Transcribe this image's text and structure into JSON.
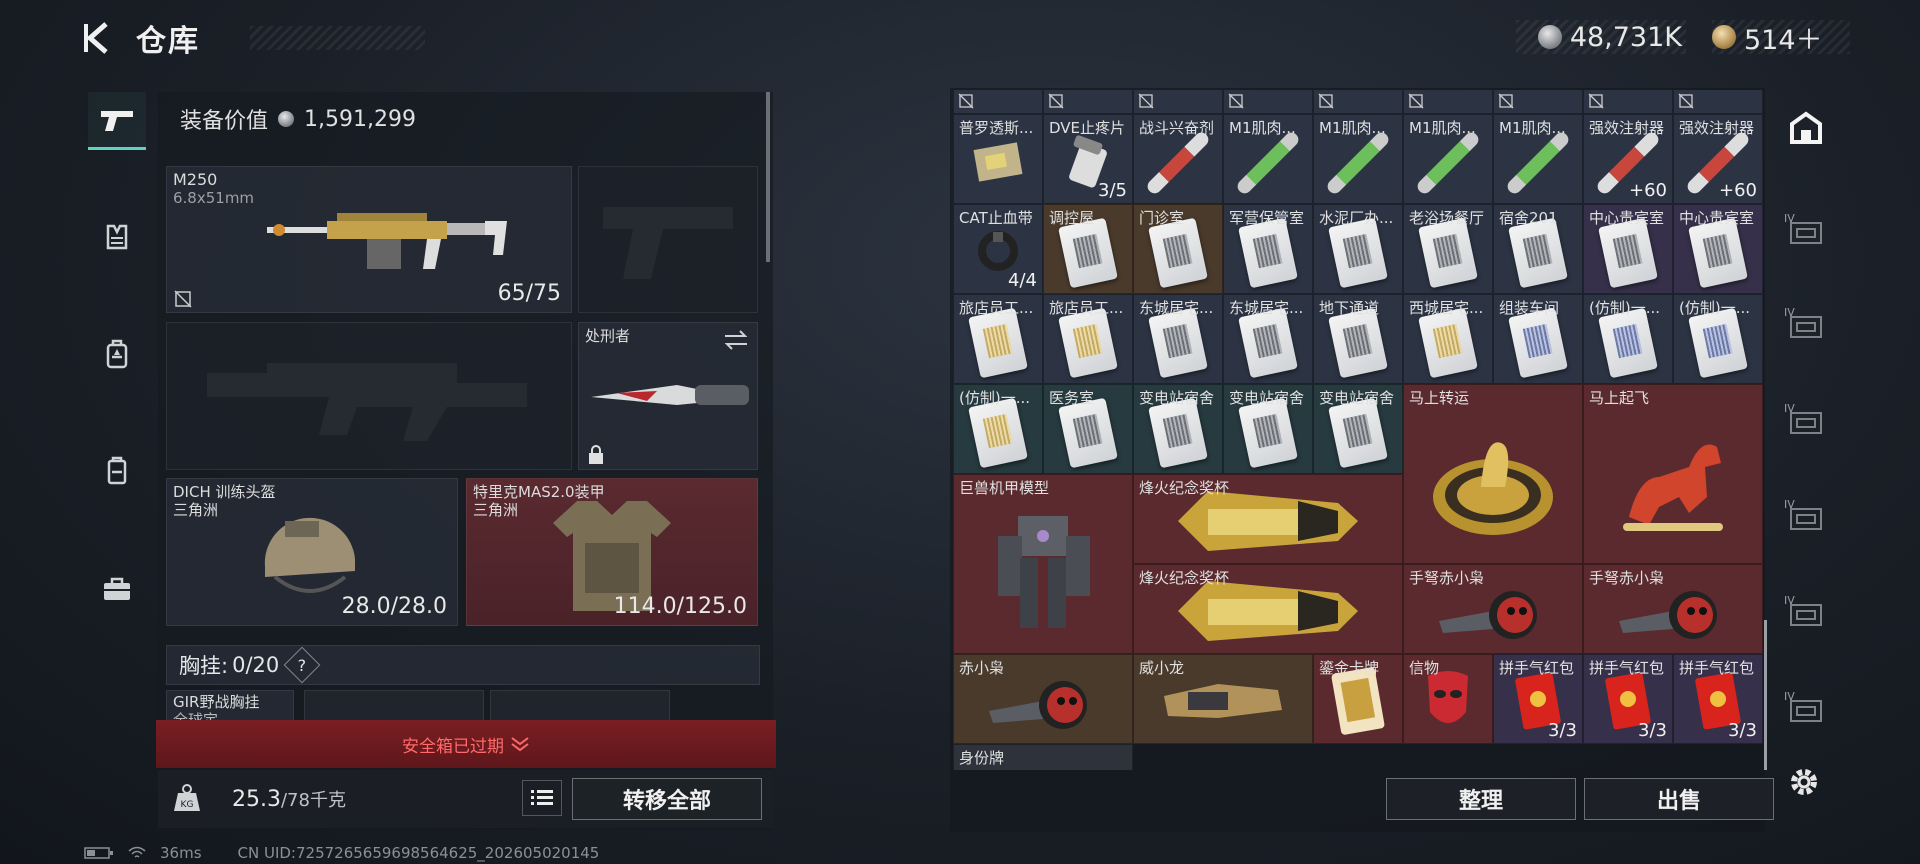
{
  "header": {
    "title": "仓库",
    "silver": "48,731K",
    "gold": "514＋"
  },
  "equipment": {
    "value_label": "装备价值",
    "value": "1,591,299",
    "primary": {
      "name": "M250",
      "caliber": "6.8x51mm",
      "ammo": "65/75"
    },
    "melee": {
      "label": "处刑者"
    },
    "helmet": {
      "name": "DICH 训练头盔",
      "origin": "三角洲",
      "durability": "28.0/28.0"
    },
    "armor": {
      "name": "特里克MAS2.0装甲",
      "origin": "三角洲",
      "durability": "114.0/125.0"
    },
    "chest": {
      "label": "胸挂:",
      "value": "0/20",
      "help": "?"
    },
    "chest_item": {
      "name": "GIR野战胸挂",
      "sub": "全球定..."
    },
    "safebox": "安全箱已过期",
    "weight": "25.3",
    "weight_max": "/78千克",
    "transfer_all": "转移全部"
  },
  "storage": {
    "sort_label": "整理",
    "sell_label": "出售",
    "last_row_label": "身份牌",
    "rows": [
      [
        {
          "name": "普罗透斯...",
          "count": "",
          "color": "bg-blue",
          "icon": "kit"
        },
        {
          "name": "DVE止疼片",
          "count": "3/5",
          "color": "bg-blue",
          "icon": "pills"
        },
        {
          "name": "战斗兴奋剂",
          "count": "",
          "color": "bg-blue",
          "icon": "syr-red"
        },
        {
          "name": "M1肌肉...",
          "count": "",
          "color": "bg-blue",
          "icon": "syr-green"
        },
        {
          "name": "M1肌肉...",
          "count": "",
          "color": "bg-blue",
          "icon": "syr-green"
        },
        {
          "name": "M1肌肉...",
          "count": "",
          "color": "bg-blue",
          "icon": "syr-green"
        },
        {
          "name": "M1肌肉...",
          "count": "",
          "color": "bg-blue",
          "icon": "syr-green"
        },
        {
          "name": "强效注射器",
          "count": "+60",
          "color": "bg-blue",
          "icon": "syr-red"
        },
        {
          "name": "强效注射器",
          "count": "+60",
          "color": "bg-blue",
          "icon": "syr-red"
        }
      ],
      [
        {
          "name": "CAT止血带",
          "count": "4/4",
          "color": "bg-blue",
          "icon": "tourniquet"
        },
        {
          "name": "调控屋",
          "count": "",
          "color": "bg-brown",
          "icon": "card"
        },
        {
          "name": "门诊室",
          "count": "",
          "color": "bg-brown",
          "icon": "card"
        },
        {
          "name": "军营保管室",
          "count": "",
          "color": "bg-blue",
          "icon": "card"
        },
        {
          "name": "水泥厂办...",
          "count": "",
          "color": "bg-blue",
          "icon": "card"
        },
        {
          "name": "老浴场餐厅",
          "count": "",
          "color": "bg-blue",
          "icon": "card"
        },
        {
          "name": "宿舍201",
          "count": "",
          "color": "bg-blue",
          "icon": "card"
        },
        {
          "name": "中心贵宾室",
          "count": "",
          "color": "bg-purple",
          "icon": "card"
        },
        {
          "name": "中心贵宾室",
          "count": "",
          "color": "bg-purple",
          "icon": "card"
        }
      ],
      [
        {
          "name": "旅店员工...",
          "count": "",
          "color": "bg-blue",
          "icon": "card-gold"
        },
        {
          "name": "旅店员工...",
          "count": "",
          "color": "bg-blue",
          "icon": "card-gold"
        },
        {
          "name": "东城居宅...",
          "count": "",
          "color": "bg-blue",
          "icon": "card"
        },
        {
          "name": "东城居宅...",
          "count": "",
          "color": "bg-blue",
          "icon": "card"
        },
        {
          "name": "地下通道",
          "count": "",
          "color": "bg-blue",
          "icon": "card"
        },
        {
          "name": "西城居宅...",
          "count": "",
          "color": "bg-blue",
          "icon": "card-gold"
        },
        {
          "name": "组装车间",
          "count": "",
          "color": "bg-blue",
          "icon": "card-blue"
        },
        {
          "name": "(仿制)一...",
          "count": "",
          "color": "bg-blue",
          "icon": "card-blue"
        },
        {
          "name": "(仿制)一...",
          "count": "",
          "color": "bg-blue",
          "icon": "card-blue"
        }
      ],
      [
        {
          "name": "(仿制)一...",
          "count": "",
          "color": "bg-teal",
          "icon": "card-gold"
        },
        {
          "name": "医务室",
          "count": "",
          "color": "bg-teal",
          "icon": "card"
        },
        {
          "name": "变电站宿舍",
          "count": "",
          "color": "bg-teal",
          "icon": "card"
        },
        {
          "name": "变电站宿舍",
          "count": "",
          "color": "bg-teal",
          "icon": "card"
        },
        {
          "name": "变电站宿舍",
          "count": "",
          "color": "bg-teal",
          "icon": "card"
        }
      ]
    ],
    "big_items": [
      {
        "name": "马上转运",
        "count": "",
        "color": "bg-red",
        "icon": "compass"
      },
      {
        "name": "马上起飞",
        "count": "",
        "color": "bg-red",
        "icon": "horse"
      },
      {
        "name": "巨兽机甲模型",
        "count": "",
        "color": "bg-red",
        "icon": "mech"
      },
      {
        "name": "烽火纪念奖杯",
        "count": "",
        "color": "bg-red",
        "icon": "trophy"
      },
      {
        "name": "烽火纪念奖杯",
        "count": "",
        "color": "bg-red",
        "icon": "trophy"
      },
      {
        "name": "手弩赤小枭",
        "count": "",
        "color": "bg-red",
        "icon": "crossbow"
      },
      {
        "name": "手弩赤小枭",
        "count": "",
        "color": "bg-red",
        "icon": "crossbow"
      }
    ],
    "last_row": [
      {
        "name": "赤小枭",
        "count": "",
        "color": "bg-brown",
        "icon": "crossbow"
      },
      {
        "name": "威小龙",
        "count": "",
        "color": "bg-brown",
        "icon": "gauntlet"
      },
      {
        "name": "鎏金卡牌",
        "count": "",
        "color": "bg-red",
        "icon": "goldcard"
      },
      {
        "name": "信物",
        "count": "",
        "color": "bg-red",
        "icon": "mask"
      },
      {
        "name": "拼手气红包",
        "count": "3/3",
        "color": "bg-purple",
        "icon": "envelope"
      },
      {
        "name": "拼手气红包",
        "count": "3/3",
        "color": "bg-purple",
        "icon": "envelope"
      },
      {
        "name": "拼手气红包",
        "count": "3/3",
        "color": "bg-purple",
        "icon": "envelope"
      }
    ]
  },
  "right_nav": [
    {
      "icon": "home-icon"
    },
    {
      "tag": "IV"
    },
    {
      "tag": "IV"
    },
    {
      "tag": "IV"
    },
    {
      "tag": "IV"
    },
    {
      "tag": "IV"
    },
    {
      "tag": "IV"
    }
  ],
  "status": {
    "ping": "36ms",
    "uid": "CN UID:7257265659698564625_202605020145"
  },
  "colors": {
    "accent": "#5fd3c2",
    "warning": "#ff6a6a",
    "rarity_blue": "#2c3444",
    "rarity_red": "#5a2a2e",
    "rarity_purple": "#36304a"
  }
}
